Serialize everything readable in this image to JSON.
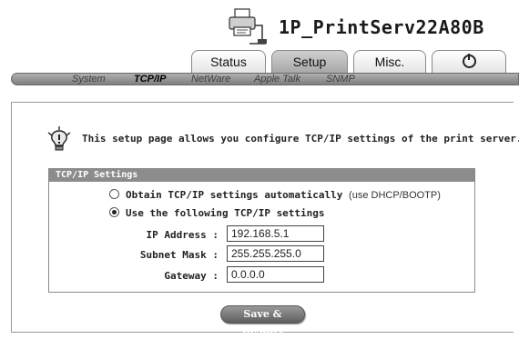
{
  "header": {
    "device_name": "1P_PrintServ22A80B",
    "icon": "printer-network-icon"
  },
  "tabs": [
    {
      "label": "Status",
      "active": false
    },
    {
      "label": "Setup",
      "active": true
    },
    {
      "label": "Misc.",
      "active": false
    },
    {
      "label": "",
      "icon": "power-icon",
      "active": false
    }
  ],
  "subnav": [
    {
      "label": "System",
      "active": false
    },
    {
      "label": "TCP/IP",
      "active": true
    },
    {
      "label": "NetWare",
      "active": false
    },
    {
      "label": "Apple Talk",
      "active": false
    },
    {
      "label": "SNMP",
      "active": false
    }
  ],
  "info": {
    "icon": "lightbulb-icon",
    "text": "This setup page allows you configure TCP/IP settings of the print server."
  },
  "panel": {
    "title": "TCP/IP Settings",
    "options": [
      {
        "label": "Obtain TCP/IP settings automatically",
        "hint": "(use DHCP/BOOTP)",
        "checked": false
      },
      {
        "label": "Use the following TCP/IP settings",
        "hint": "",
        "checked": true
      }
    ],
    "fields": [
      {
        "label": "IP Address :",
        "value": "192.168.5.1"
      },
      {
        "label": "Subnet Mask :",
        "value": "255.255.255.0"
      },
      {
        "label": "Gateway :",
        "value": "0.0.0.0"
      }
    ]
  },
  "save_button": "Save & Restart"
}
